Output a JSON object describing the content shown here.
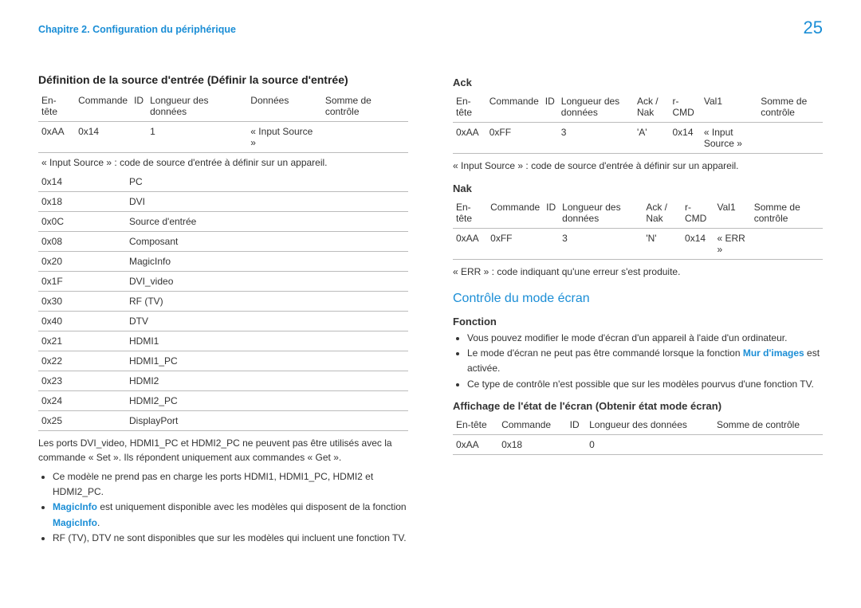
{
  "page_number": "25",
  "chapter": "Chapitre 2. Configuration du périphérique",
  "left": {
    "heading": "Définition de la source d'entrée (Définir la source d'entrée)",
    "table1": {
      "headers": [
        "En-tête",
        "Commande",
        "ID",
        "Longueur des données",
        "Données",
        "Somme de contrôle"
      ],
      "row": [
        "0xAA",
        "0x14",
        "",
        "1",
        "« Input Source »",
        ""
      ]
    },
    "note1": "« Input Source » : code de source d'entrée à définir sur un appareil.",
    "sources": [
      [
        "0x14",
        "PC"
      ],
      [
        "0x18",
        "DVI"
      ],
      [
        "0x0C",
        "Source d'entrée"
      ],
      [
        "0x08",
        "Composant"
      ],
      [
        "0x20",
        "MagicInfo"
      ],
      [
        "0x1F",
        "DVI_video"
      ],
      [
        "0x30",
        "RF (TV)"
      ],
      [
        "0x40",
        "DTV"
      ],
      [
        "0x21",
        "HDMI1"
      ],
      [
        "0x22",
        "HDMI1_PC"
      ],
      [
        "0x23",
        "HDMI2"
      ],
      [
        "0x24",
        "HDMI2_PC"
      ],
      [
        "0x25",
        "DisplayPort"
      ]
    ],
    "note2": "Les ports DVI_video, HDMI1_PC et HDMI2_PC ne peuvent pas être utilisés avec la commande « Set ». Ils répondent uniquement aux commandes « Get ».",
    "bullets": [
      {
        "text": "Ce modèle ne prend pas en charge les ports HDMI1, HDMI1_PC, HDMI2 et HDMI2_PC."
      },
      {
        "prefix": "MagicInfo",
        "rest": " est uniquement disponible avec les modèles qui disposent de la fonction ",
        "suffix": "MagicInfo",
        "trail": "."
      },
      {
        "text": "RF (TV), DTV ne sont disponibles que sur les modèles qui incluent une fonction TV."
      }
    ]
  },
  "right": {
    "ack_heading": "Ack",
    "ack_table": {
      "headers": [
        "En-tête",
        "Commande",
        "ID",
        "Longueur des données",
        "Ack / Nak",
        "r-CMD",
        "Val1",
        "Somme de contrôle"
      ],
      "row": [
        "0xAA",
        "0xFF",
        "",
        "3",
        "'A'",
        "0x14",
        "« Input Source »",
        ""
      ]
    },
    "ack_note": "« Input Source » : code de source d'entrée à définir sur un appareil.",
    "nak_heading": "Nak",
    "nak_table": {
      "headers": [
        "En-tête",
        "Commande",
        "ID",
        "Longueur des données",
        "Ack / Nak",
        "r-CMD",
        "Val1",
        "Somme de contrôle"
      ],
      "row": [
        "0xAA",
        "0xFF",
        "",
        "3",
        "'N'",
        "0x14",
        "« ERR »",
        ""
      ]
    },
    "nak_note": "« ERR » : code indiquant qu'une erreur s'est produite.",
    "section2_heading": "Contrôle du mode écran",
    "fonction_heading": "Fonction",
    "fonction_bullets": [
      "Vous pouvez modifier le mode d'écran d'un appareil à l'aide d'un ordinateur.",
      {
        "pre": "Le mode d'écran ne peut pas être commandé lorsque la fonction ",
        "link": "Mur d'images",
        "post": " est activée."
      },
      "Ce type de contrôle n'est possible que sur les modèles pourvus d'une fonction TV."
    ],
    "aff_heading": "Affichage de l'état de l'écran (Obtenir état mode écran)",
    "aff_table": {
      "headers": [
        "En-tête",
        "Commande",
        "ID",
        "Longueur des données",
        "Somme de contrôle"
      ],
      "row": [
        "0xAA",
        "0x18",
        "",
        "0",
        ""
      ]
    }
  }
}
